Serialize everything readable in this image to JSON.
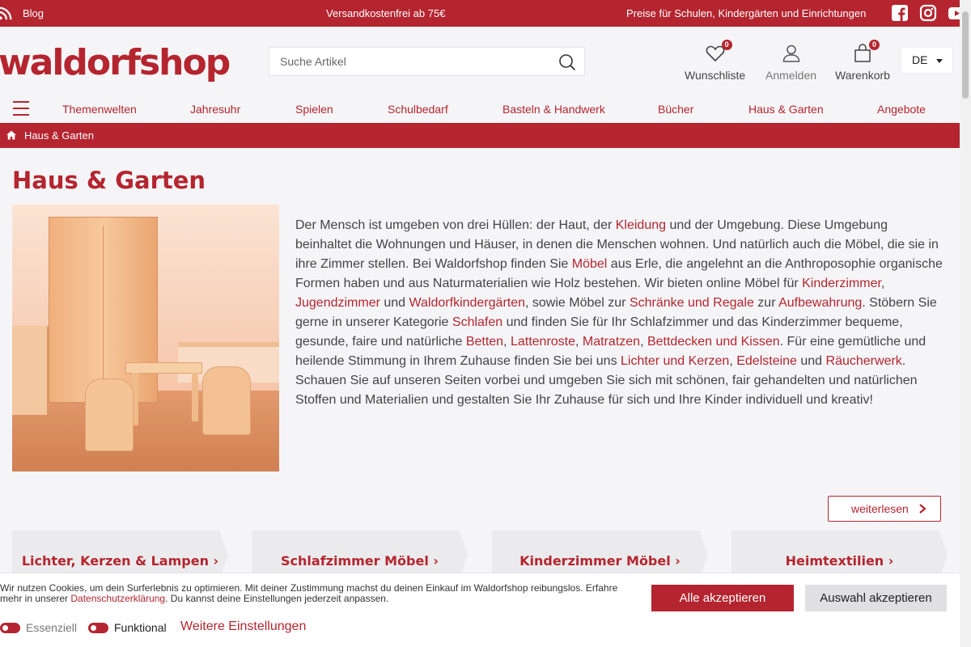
{
  "topbar": {
    "blog": "Blog",
    "shipping": "Versandkostenfrei ab 75€",
    "institutions": "Preise für Schulen, Kindergärten und Einrichtungen"
  },
  "header": {
    "logo": "waldorfshop",
    "search_placeholder": "Suche Artikel",
    "wishlist": "Wunschliste",
    "wishlist_count": "0",
    "login": "Anmelden",
    "cart": "Warenkorb",
    "cart_count": "0",
    "language": "DE"
  },
  "nav": {
    "items": [
      "Themenwelten",
      "Jahresuhr",
      "Spielen",
      "Schulbedarf",
      "Basteln & Handwerk",
      "Bücher",
      "Haus & Garten",
      "Angebote"
    ]
  },
  "breadcrumb": {
    "current": "Haus & Garten"
  },
  "page": {
    "title": "Haus & Garten",
    "desc": [
      "Der Mensch ist umgeben von drei Hüllen: der Haut, der ",
      "Kleidung",
      " und der Umgebung. Diese Umgebung beinhaltet die Wohnungen und Häuser, in denen die Menschen wohnen. Und natürlich auch die Möbel, die sie in ihre Zimmer stellen. Bei Waldorfshop finden Sie ",
      "Möbel",
      " aus Erle, die angelehnt an die Anthroposophie organische Formen haben und aus Naturmaterialien wie Holz bestehen. Wir bieten online Möbel für ",
      "Kinderzimmer",
      ", ",
      "Jugendzimmer",
      " und ",
      "Waldorfkindergärten",
      ", sowie Möbel zur ",
      "Schränke und Regale",
      " zur ",
      "Aufbewahrung",
      ". Stöbern Sie gerne in unserer Kategorie ",
      "Schlafen",
      " und finden Sie für Ihr Schlafzimmer und das Kinderzimmer bequeme, gesunde, faire und natürliche ",
      "Betten",
      ", ",
      "Lattenroste",
      ", ",
      "Matratzen",
      ", ",
      "Bettdecken und Kissen",
      ". Für eine gemütliche und heilende Stimmung in Ihrem Zuhause finden Sie bei uns ",
      "Lichter und Kerzen",
      ", ",
      "Edelsteine",
      " und ",
      "Räucherwerk",
      ". Schauen Sie auf unseren Seiten vorbei und umgeben Sie sich mit schönen, fair gehandelten und natürlichen Stoffen und Materialien und gestalten Sie Ihr Zuhause für sich und Ihre Kinder individuell und kreativ!"
    ],
    "read_more": "weiterlesen"
  },
  "tiles": [
    "Lichter, Kerzen & Lampen",
    "Schlafzimmer Möbel",
    "Kinderzimmer Möbel",
    "Heimtextilien"
  ],
  "cookie": {
    "msg_1": "Wir nutzen Cookies, um dein Surferlebnis zu optimieren. Mit deiner Zustimmung machst du deinen Einkauf im Waldorfshop reibungslos. Erfahre mehr in unserer ",
    "privacy_link": "Datenschutzerklärung",
    "msg_2": ". Du kannst deine Einstellungen jederzeit anpassen.",
    "essential": "Essenziell",
    "functional": "Funktional",
    "further_settings": "Weitere Einstellungen",
    "accept_all": "Alle akzeptieren",
    "accept_selection": "Auswahl akzeptieren"
  },
  "colors": {
    "brand": "#b5252f",
    "background": "#f5f5f7"
  }
}
